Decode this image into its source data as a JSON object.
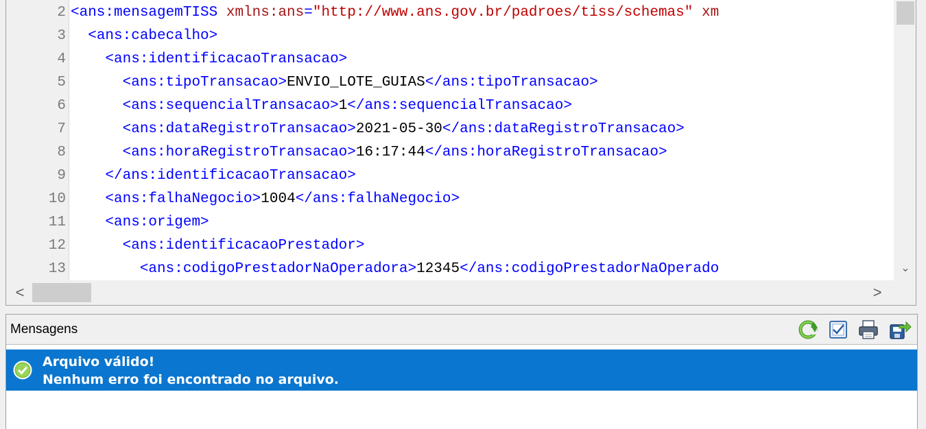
{
  "editor": {
    "lines": [
      {
        "n": "2",
        "segs": [
          [
            "tag",
            "<ans:mensagemTISS "
          ],
          [
            "an",
            "xmlns:ans"
          ],
          [
            "tag",
            "="
          ],
          [
            "av",
            "\"http://www.ans.gov.br/padroes/tiss/schemas\""
          ],
          [
            "an",
            " xm"
          ]
        ]
      },
      {
        "n": "3",
        "segs": [
          [
            "txt",
            "  "
          ],
          [
            "tag",
            "<ans:cabecalho>"
          ]
        ]
      },
      {
        "n": "4",
        "segs": [
          [
            "txt",
            "    "
          ],
          [
            "tag",
            "<ans:identificacaoTransacao>"
          ]
        ]
      },
      {
        "n": "5",
        "segs": [
          [
            "txt",
            "      "
          ],
          [
            "tag",
            "<ans:tipoTransacao>"
          ],
          [
            "txt",
            "ENVIO_LOTE_GUIAS"
          ],
          [
            "tag",
            "</ans:tipoTransacao>"
          ]
        ]
      },
      {
        "n": "6",
        "segs": [
          [
            "txt",
            "      "
          ],
          [
            "tag",
            "<ans:sequencialTransacao>"
          ],
          [
            "txt",
            "1"
          ],
          [
            "tag",
            "</ans:sequencialTransacao>"
          ]
        ]
      },
      {
        "n": "7",
        "segs": [
          [
            "txt",
            "      "
          ],
          [
            "tag",
            "<ans:dataRegistroTransacao>"
          ],
          [
            "txt",
            "2021-05-30"
          ],
          [
            "tag",
            "</ans:dataRegistroTransacao>"
          ]
        ]
      },
      {
        "n": "8",
        "segs": [
          [
            "txt",
            "      "
          ],
          [
            "tag",
            "<ans:horaRegistroTransacao>"
          ],
          [
            "txt",
            "16:17:44"
          ],
          [
            "tag",
            "</ans:horaRegistroTransacao>"
          ]
        ]
      },
      {
        "n": "9",
        "segs": [
          [
            "txt",
            "    "
          ],
          [
            "tag",
            "</ans:identificacaoTransacao>"
          ]
        ]
      },
      {
        "n": "10",
        "segs": [
          [
            "txt",
            "    "
          ],
          [
            "tag",
            "<ans:falhaNegocio>"
          ],
          [
            "txt",
            "1004"
          ],
          [
            "tag",
            "</ans:falhaNegocio>"
          ]
        ]
      },
      {
        "n": "11",
        "segs": [
          [
            "txt",
            "    "
          ],
          [
            "tag",
            "<ans:origem>"
          ]
        ]
      },
      {
        "n": "12",
        "segs": [
          [
            "txt",
            "      "
          ],
          [
            "tag",
            "<ans:identificacaoPrestador>"
          ]
        ]
      },
      {
        "n": "13",
        "segs": [
          [
            "txt",
            "        "
          ],
          [
            "tag",
            "<ans:codigoPrestadorNaOperadora>"
          ],
          [
            "txt",
            "12345"
          ],
          [
            "tag",
            "</ans:codigoPrestadorNaOperado"
          ]
        ]
      }
    ]
  },
  "scrollbars": {
    "down_arrow": "⌄",
    "left_arrow": "<",
    "right_arrow": ">"
  },
  "messages": {
    "title": "Mensagens",
    "toolbar": [
      {
        "name": "refresh-icon"
      },
      {
        "name": "validate-icon"
      },
      {
        "name": "print-icon"
      },
      {
        "name": "export-icon"
      }
    ],
    "items": [
      {
        "line1": "Arquivo válido!",
        "line2": "Nenhum erro foi encontrado no arquivo.",
        "status": "success"
      }
    ]
  },
  "colors": {
    "tag": "#0000ff",
    "attr_name": "#a31515",
    "attr_value": "#c00000",
    "selection": "#0a76cf",
    "success": "#7cc242"
  }
}
